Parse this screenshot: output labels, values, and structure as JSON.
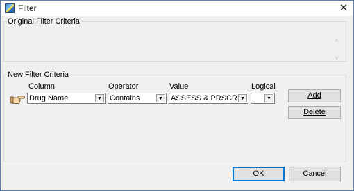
{
  "window": {
    "title": "Filter",
    "close_glyph": "✕",
    "icon": "filter-app-icon"
  },
  "original_criteria": {
    "legend": "Original Filter Criteria",
    "scroll_up_glyph": "˄",
    "scroll_down_glyph": "˅"
  },
  "new_criteria": {
    "legend": "New Filter Criteria",
    "columns": {
      "column": "Column",
      "operator": "Operator",
      "value": "Value",
      "logical": "Logical"
    },
    "row": {
      "column_value": "Drug Name",
      "operator_value": "Contains",
      "value_value": "ASSESS & PRSCRB",
      "logical_value": ""
    },
    "dropdown_glyph": "▼",
    "add_label": "Add",
    "delete_label": "Delete",
    "pointer_icon": "pointing-hand-icon"
  },
  "footer": {
    "ok_label": "OK",
    "cancel_label": "Cancel"
  },
  "colors": {
    "window_border": "#5b7fb0",
    "dialog_bg": "#f0f0f0",
    "button_bg": "#e1e1e1",
    "default_button_border": "#0078d7"
  }
}
